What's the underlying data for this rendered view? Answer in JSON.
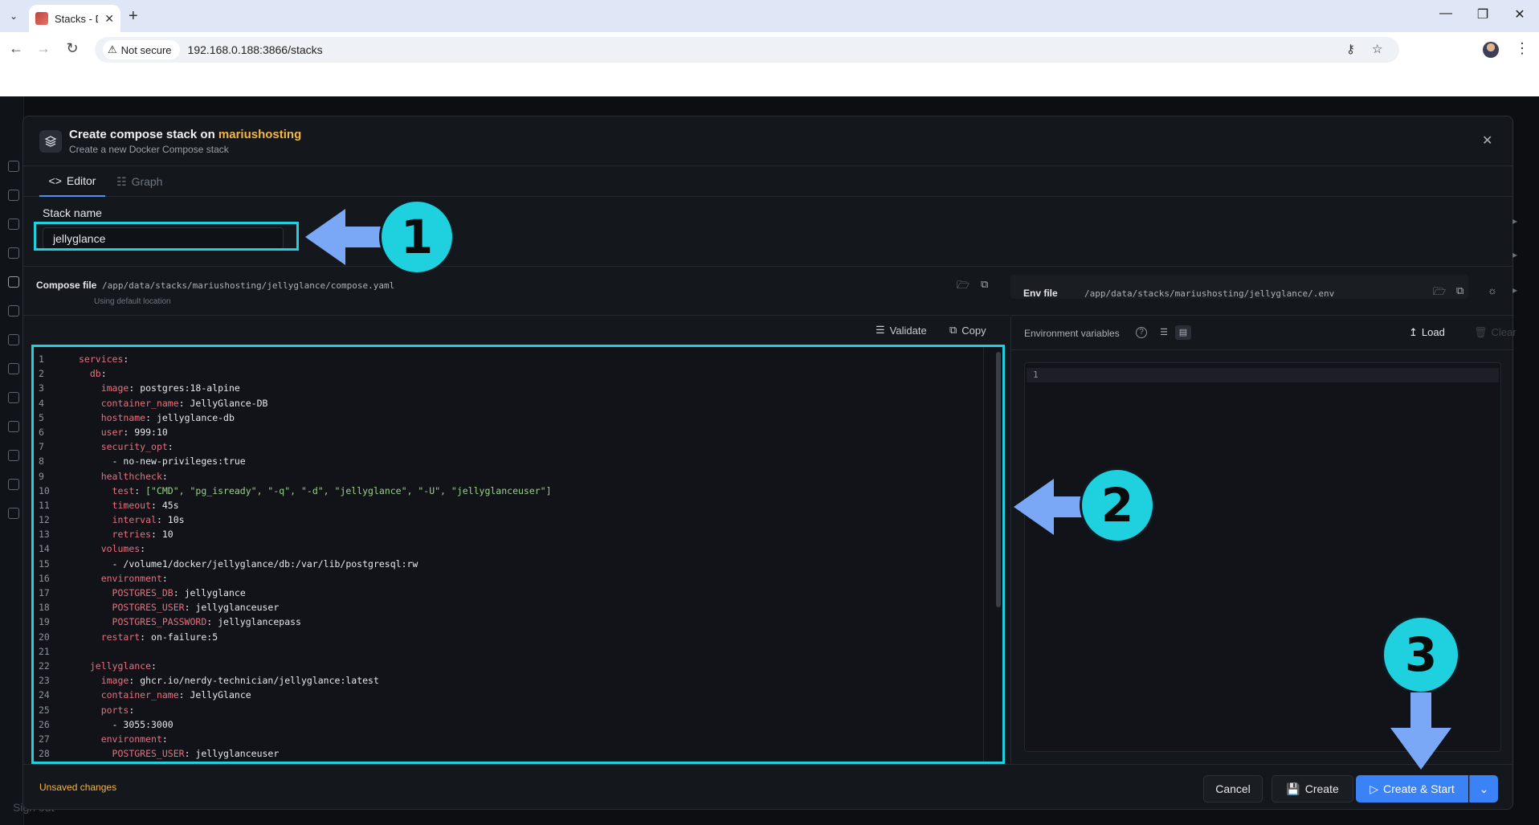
{
  "browser": {
    "tab_title": "Stacks - D",
    "not_secure_label": "Not secure",
    "url": "192.168.0.188:3866/stacks"
  },
  "modal": {
    "title_prefix": "Create compose stack on ",
    "host": "mariushosting",
    "subtitle": "Create a new Docker Compose stack",
    "tabs": {
      "editor": "Editor",
      "graph": "Graph"
    },
    "stack_name_label": "Stack name",
    "stack_name_value": "jellyglance",
    "compose_label": "Compose file",
    "compose_path": "/app/data/stacks/mariushosting/jellyglance/compose.yaml",
    "compose_hint": "Using default location",
    "env_label": "Env file",
    "env_path": "/app/data/stacks/mariushosting/jellyglance/.env",
    "validate_label": "Validate",
    "copy_label": "Copy",
    "env_vars_label": "Environment variables",
    "load_label": "Load",
    "clear_label": "Clear",
    "env_line_number": "1",
    "unsaved_label": "Unsaved changes",
    "cancel_label": "Cancel",
    "create_label": "Create",
    "create_start_label": "Create & Start"
  },
  "code_lines": [
    {
      "n": "1",
      "ind": "",
      "k": "services",
      "v": ""
    },
    {
      "n": "2",
      "ind": "  ",
      "k": "db",
      "v": ""
    },
    {
      "n": "3",
      "ind": "    ",
      "k": "image",
      "v": " postgres:18-alpine"
    },
    {
      "n": "4",
      "ind": "    ",
      "k": "container_name",
      "v": " JellyGlance-DB"
    },
    {
      "n": "5",
      "ind": "    ",
      "k": "hostname",
      "v": " jellyglance-db"
    },
    {
      "n": "6",
      "ind": "    ",
      "k": "user",
      "v": " 999:10"
    },
    {
      "n": "7",
      "ind": "    ",
      "k": "security_opt",
      "v": ""
    },
    {
      "n": "8",
      "ind": "      ",
      "k": "",
      "v": "- no-new-privileges:true"
    },
    {
      "n": "9",
      "ind": "    ",
      "k": "healthcheck",
      "v": ""
    },
    {
      "n": "10",
      "ind": "      ",
      "k": "test",
      "v": " [\"CMD\", \"pg_isready\", \"-q\", \"-d\", \"jellyglance\", \"-U\", \"jellyglanceuser\"]"
    },
    {
      "n": "11",
      "ind": "      ",
      "k": "timeout",
      "v": " 45s"
    },
    {
      "n": "12",
      "ind": "      ",
      "k": "interval",
      "v": " 10s"
    },
    {
      "n": "13",
      "ind": "      ",
      "k": "retries",
      "v": " 10"
    },
    {
      "n": "14",
      "ind": "    ",
      "k": "volumes",
      "v": ""
    },
    {
      "n": "15",
      "ind": "      ",
      "k": "",
      "v": "- /volume1/docker/jellyglance/db:/var/lib/postgresql:rw"
    },
    {
      "n": "16",
      "ind": "    ",
      "k": "environment",
      "v": ""
    },
    {
      "n": "17",
      "ind": "      ",
      "k": "POSTGRES_DB",
      "v": " jellyglance"
    },
    {
      "n": "18",
      "ind": "      ",
      "k": "POSTGRES_USER",
      "v": " jellyglanceuser"
    },
    {
      "n": "19",
      "ind": "      ",
      "k": "POSTGRES_PASSWORD",
      "v": " jellyglancepass"
    },
    {
      "n": "20",
      "ind": "    ",
      "k": "restart",
      "v": " on-failure:5"
    },
    {
      "n": "21",
      "ind": "",
      "k": "",
      "v": ""
    },
    {
      "n": "22",
      "ind": "  ",
      "k": "jellyglance",
      "v": ""
    },
    {
      "n": "23",
      "ind": "    ",
      "k": "image",
      "v": " ghcr.io/nerdy-technician/jellyglance:latest"
    },
    {
      "n": "24",
      "ind": "    ",
      "k": "container_name",
      "v": " JellyGlance"
    },
    {
      "n": "25",
      "ind": "    ",
      "k": "ports",
      "v": ""
    },
    {
      "n": "26",
      "ind": "      ",
      "k": "",
      "v": "- 3055:3000"
    },
    {
      "n": "27",
      "ind": "    ",
      "k": "environment",
      "v": ""
    },
    {
      "n": "28",
      "ind": "      ",
      "k": "POSTGRES_USER",
      "v": " jellyglanceuser"
    }
  ],
  "background": {
    "signout_label": "Sign out"
  },
  "annotations": {
    "one": "1",
    "two": "2",
    "three": "3"
  },
  "colors": {
    "highlight": "#1fd1de",
    "arrow": "#7aa8f7",
    "accent": "#3b82f6",
    "host": "#f5b544"
  }
}
